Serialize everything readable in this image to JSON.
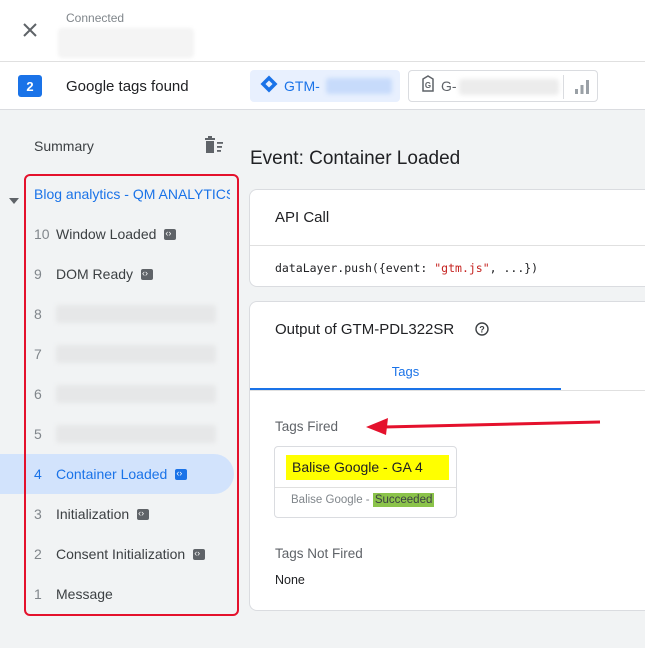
{
  "header": {
    "status_label": "Connected"
  },
  "tags_bar": {
    "count": "2",
    "found_label": "Google tags found",
    "gtm_chip_prefix": "GTM-",
    "g_chip_prefix": "G-"
  },
  "sidebar": {
    "summary_label": "Summary",
    "group_title": "Blog analytics - QM ANALYTICS",
    "events": [
      {
        "num": "10",
        "label": "Window Loaded",
        "has_code": true
      },
      {
        "num": "9",
        "label": "DOM Ready",
        "has_code": true
      },
      {
        "num": "8",
        "label": "",
        "has_code": false
      },
      {
        "num": "7",
        "label": "",
        "has_code": false
      },
      {
        "num": "6",
        "label": "",
        "has_code": false
      },
      {
        "num": "5",
        "label": "",
        "has_code": false
      },
      {
        "num": "4",
        "label": "Container Loaded",
        "has_code": true,
        "active": true
      },
      {
        "num": "3",
        "label": "Initialization",
        "has_code": true
      },
      {
        "num": "2",
        "label": "Consent Initialization",
        "has_code": true
      },
      {
        "num": "1",
        "label": "Message",
        "has_code": false
      }
    ]
  },
  "main": {
    "event_title": "Event: Container Loaded",
    "api_call": {
      "title": "API Call",
      "code_prefix": "dataLayer.push({event: ",
      "code_string": "\"gtm.js\"",
      "code_suffix": ", ...})"
    },
    "output": {
      "title": "Output of GTM-PDL322SR",
      "tab_label": "Tags",
      "fired_label": "Tags Fired",
      "fired_tag": {
        "name": "Balise Google - GA 4",
        "type": "Balise Google - ",
        "status": "Succeeded"
      },
      "not_fired_label": "Tags Not Fired",
      "not_fired_value": "None"
    }
  },
  "colors": {
    "accent": "#1a73e8",
    "highlight": "#ffff00",
    "success": "#8bc34a",
    "annotation_red": "#e4112c"
  }
}
